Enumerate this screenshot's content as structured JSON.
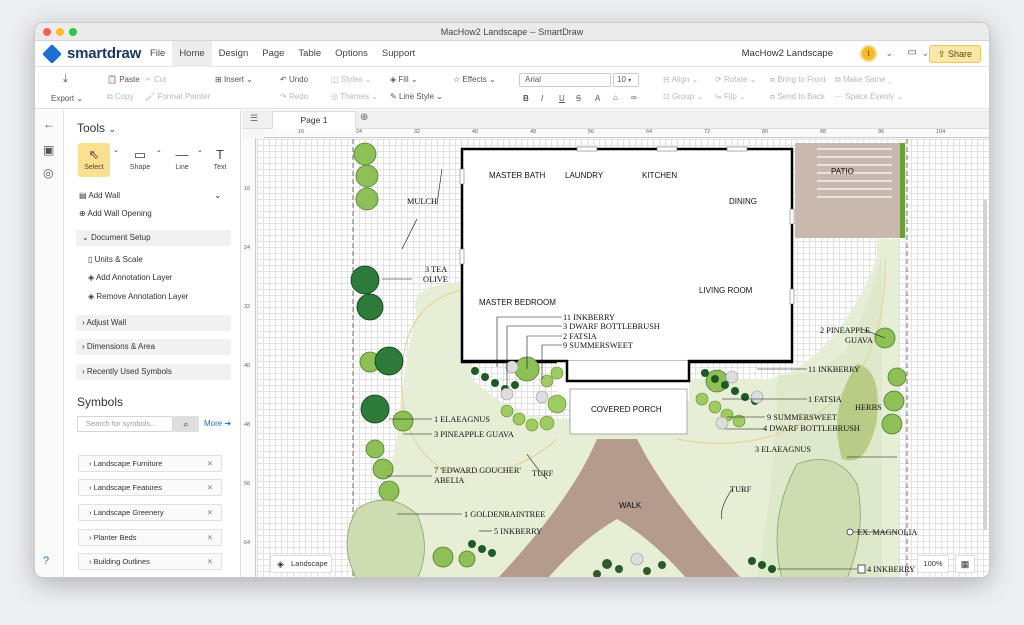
{
  "window": {
    "title": "MacHow2 Landscape -- SmartDraw"
  },
  "app": {
    "logo_text": "smartdraw"
  },
  "menu": {
    "items": [
      "File",
      "Home",
      "Design",
      "Page",
      "Table",
      "Options",
      "Support"
    ],
    "active": "Home"
  },
  "header": {
    "doc_name": "MacHow2 Landscape",
    "avatar_letter": "t",
    "share_label": "Share"
  },
  "ribbon": {
    "export": "Export",
    "paste": "Paste",
    "cut": "Cut",
    "copy": "Copy",
    "format_painter": "Format Painter",
    "insert": "Insert",
    "undo": "Undo",
    "redo": "Redo",
    "styles": "Styles",
    "themes": "Themes",
    "fill": "Fill",
    "line_style": "Line Style",
    "effects": "Effects",
    "font": "Arial",
    "font_size": "10",
    "align": "Align",
    "group": "Group",
    "rotate": "Rotate",
    "flip": "Flip",
    "bring_front": "Bring to Front",
    "send_back": "Send to Back",
    "make_same": "Make Same",
    "space_evenly": "Space Evenly"
  },
  "tools": {
    "heading": "Tools",
    "items": [
      {
        "label": "Select",
        "icon": "cursor-icon"
      },
      {
        "label": "Shape",
        "icon": "rectangle-icon"
      },
      {
        "label": "Line",
        "icon": "line-icon"
      },
      {
        "label": "Text",
        "icon": "text-icon"
      }
    ],
    "add_wall": "Add Wall",
    "add_wall_opening": "Add Wall Opening",
    "document_setup": "Document Setup",
    "units_scale": "Units & Scale",
    "add_annotation_layer": "Add Annotation Layer",
    "remove_annotation_layer": "Remove Annotation Layer",
    "adjust_wall": "Adjust Wall",
    "dimensions_area": "Dimensions & Area",
    "recently_used": "Recently Used Symbols"
  },
  "symbols": {
    "heading": "Symbols",
    "search_placeholder": "Search for symbols...",
    "more": "More",
    "libraries": [
      "Landscape Furniture",
      "Landscape Features",
      "Landscape Greenery",
      "Planter Beds",
      "Building Outlines"
    ]
  },
  "canvas": {
    "page_tab": "Page 1",
    "layer_button": "Landscape",
    "zoom": "100%",
    "ruler_h": [
      "16",
      "24",
      "32",
      "40",
      "48",
      "56",
      "64",
      "72",
      "80",
      "88",
      "96",
      "104"
    ],
    "ruler_v": [
      "16",
      "24",
      "32",
      "40",
      "48",
      "56",
      "64"
    ]
  },
  "plan": {
    "rooms": {
      "master_bath": "MASTER BATH",
      "laundry": "LAUNDRY",
      "kitchen": "KITCHEN",
      "dining": "DINING",
      "master_bedroom": "MASTER BEDROOM",
      "living_room": "LIVING ROOM",
      "covered_porch": "COVERED PORCH",
      "patio": "PATIO",
      "walk": "WALK"
    },
    "labels": {
      "mulch": "MULCH",
      "tea_olive_1": "3 TEA",
      "tea_olive_2": "OLIVE",
      "inkberry_11": "11 INKBERRY",
      "bottlebrush_3": "3 DWARF BOTTLEBRUSH",
      "fatsia_2": "2 FATSIA",
      "summersweet_9": "9 SUMMERSWEET",
      "elaeagnus_1": "1 ELAEAGNUS",
      "pineapple_guava_3": "3 PINEAPPLE GUAVA",
      "abelia_1": "7  'EDWARD GOUCHER'",
      "abelia_2": "ABELIA",
      "goldenraintree": "1 GOLDENRAINTREE",
      "inkberry_5": "5 INKBERRY",
      "turf_left": "TURF",
      "turf_right": "TURF",
      "pineapple_guava_2a": "2 PINEAPPLE",
      "pineapple_guava_2b": "GUAVA",
      "inkberry_11_right": "11 INKBERRY",
      "fatsia_1": "1 FATSIA",
      "herbs": "HERBS",
      "summersweet_9_right": "9 SUMMERSWEET",
      "bottlebrush_4": "4 DWARF BOTTLEBRUSH",
      "elaeagnus_3": "3 ELAEAGNUS",
      "magnolia": "EX. MAGNOLIA",
      "inkberry_4": "4 INKBERRY"
    }
  }
}
